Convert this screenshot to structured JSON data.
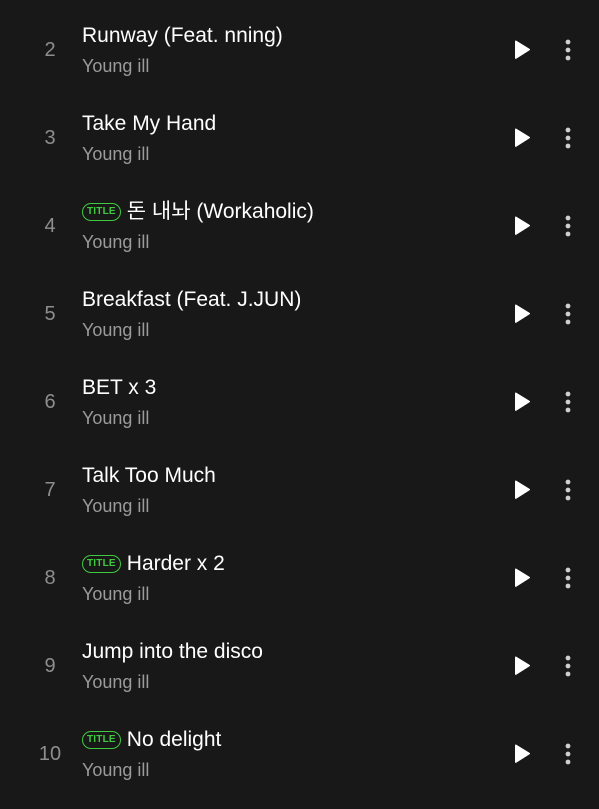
{
  "tracks": [
    {
      "number": "2",
      "title": "Runway (Feat. nning)",
      "artist": "Young ill",
      "badge": ""
    },
    {
      "number": "3",
      "title": "Take My Hand",
      "artist": "Young ill",
      "badge": ""
    },
    {
      "number": "4",
      "title": "돈 내놔 (Workaholic)",
      "artist": "Young ill",
      "badge": "TITLE"
    },
    {
      "number": "5",
      "title": "Breakfast (Feat. J.JUN)",
      "artist": "Young ill",
      "badge": ""
    },
    {
      "number": "6",
      "title": "BET x 3",
      "artist": "Young ill",
      "badge": ""
    },
    {
      "number": "7",
      "title": "Talk Too Much",
      "artist": "Young ill",
      "badge": ""
    },
    {
      "number": "8",
      "title": "Harder x 2",
      "artist": "Young ill",
      "badge": "TITLE"
    },
    {
      "number": "9",
      "title": "Jump into the disco",
      "artist": "Young ill",
      "badge": ""
    },
    {
      "number": "10",
      "title": "No delight",
      "artist": "Young ill",
      "badge": "TITLE"
    }
  ],
  "icons": {
    "play": "play-icon",
    "more": "more-vertical-icon"
  },
  "colors": {
    "background": "#181818",
    "title": "#ffffff",
    "artist": "#9b9b9b",
    "number": "#8e8e8e",
    "badge": "#3ec93e"
  }
}
